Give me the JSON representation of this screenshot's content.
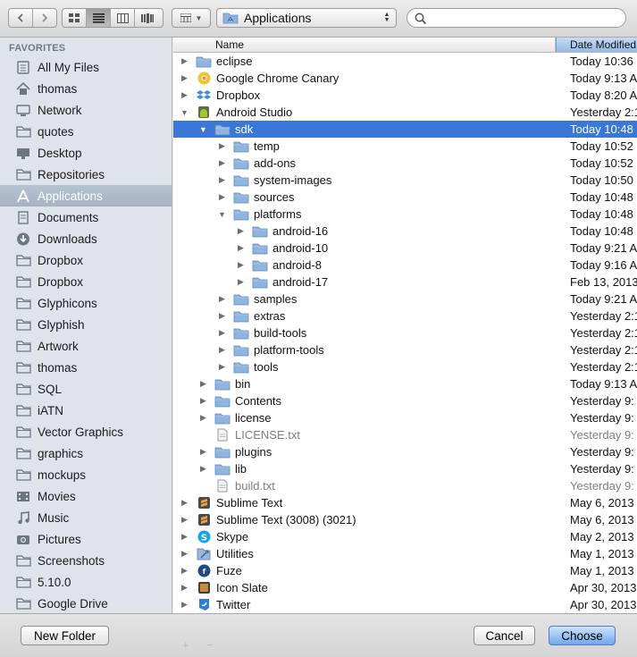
{
  "toolbar": {
    "back_icon": "chevron-left-icon",
    "forward_icon": "chevron-right-icon",
    "view_icons": [
      "icon-view-icon",
      "list-view-icon",
      "column-view-icon",
      "coverflow-view-icon"
    ],
    "path_label": "Applications",
    "search_placeholder": ""
  },
  "sidebar": {
    "heading": "FAVORITES",
    "items": [
      {
        "label": "All My Files",
        "icon": "all-files-icon"
      },
      {
        "label": "thomas",
        "icon": "home-icon"
      },
      {
        "label": "Network",
        "icon": "network-icon"
      },
      {
        "label": "quotes",
        "icon": "folder-icon"
      },
      {
        "label": "Desktop",
        "icon": "desktop-icon"
      },
      {
        "label": "Repositories",
        "icon": "folder-icon"
      },
      {
        "label": "Applications",
        "icon": "applications-icon",
        "selected": true
      },
      {
        "label": "Documents",
        "icon": "documents-icon"
      },
      {
        "label": "Downloads",
        "icon": "downloads-icon"
      },
      {
        "label": "Dropbox",
        "icon": "folder-icon"
      },
      {
        "label": "Dropbox",
        "icon": "folder-icon"
      },
      {
        "label": "Glyphicons",
        "icon": "folder-icon"
      },
      {
        "label": "Glyphish",
        "icon": "folder-icon"
      },
      {
        "label": "Artwork",
        "icon": "folder-icon"
      },
      {
        "label": "thomas",
        "icon": "folder-icon"
      },
      {
        "label": "SQL",
        "icon": "folder-icon"
      },
      {
        "label": "iATN",
        "icon": "folder-icon"
      },
      {
        "label": "Vector Graphics",
        "icon": "folder-icon"
      },
      {
        "label": "graphics",
        "icon": "folder-icon"
      },
      {
        "label": "mockups",
        "icon": "folder-icon"
      },
      {
        "label": "Movies",
        "icon": "movies-icon"
      },
      {
        "label": "Music",
        "icon": "music-icon"
      },
      {
        "label": "Pictures",
        "icon": "pictures-icon"
      },
      {
        "label": "Screenshots",
        "icon": "folder-icon"
      },
      {
        "label": "5.10.0",
        "icon": "folder-icon"
      },
      {
        "label": "Google Drive",
        "icon": "folder-icon"
      }
    ]
  },
  "list": {
    "col_name": "Name",
    "col_date": "Date Modified",
    "rows": [
      {
        "name": "eclipse",
        "date": "Today 10:36",
        "level": 0,
        "expand": "closed",
        "icon": "folder"
      },
      {
        "name": "Google Chrome Canary",
        "date": "Today 9:13 A",
        "level": 0,
        "expand": "closed",
        "icon": "chrome"
      },
      {
        "name": "Dropbox",
        "date": "Today 8:20 A",
        "level": 0,
        "expand": "closed",
        "icon": "dropbox"
      },
      {
        "name": "Android Studio",
        "date": "Yesterday 2:1",
        "level": 0,
        "expand": "open",
        "icon": "android"
      },
      {
        "name": "sdk",
        "date": "Today 10:48",
        "level": 1,
        "expand": "open",
        "icon": "folder",
        "selected": true
      },
      {
        "name": "temp",
        "date": "Today 10:52",
        "level": 2,
        "expand": "closed",
        "icon": "folder"
      },
      {
        "name": "add-ons",
        "date": "Today 10:52",
        "level": 2,
        "expand": "closed",
        "icon": "folder"
      },
      {
        "name": "system-images",
        "date": "Today 10:50",
        "level": 2,
        "expand": "closed",
        "icon": "folder"
      },
      {
        "name": "sources",
        "date": "Today 10:48",
        "level": 2,
        "expand": "closed",
        "icon": "folder"
      },
      {
        "name": "platforms",
        "date": "Today 10:48",
        "level": 2,
        "expand": "open",
        "icon": "folder"
      },
      {
        "name": "android-16",
        "date": "Today 10:48",
        "level": 3,
        "expand": "closed",
        "icon": "folder"
      },
      {
        "name": "android-10",
        "date": "Today 9:21 A",
        "level": 3,
        "expand": "closed",
        "icon": "folder"
      },
      {
        "name": "android-8",
        "date": "Today 9:16 A",
        "level": 3,
        "expand": "closed",
        "icon": "folder"
      },
      {
        "name": "android-17",
        "date": "Feb 13, 2013",
        "level": 3,
        "expand": "closed",
        "icon": "folder"
      },
      {
        "name": "samples",
        "date": "Today 9:21 A",
        "level": 2,
        "expand": "closed",
        "icon": "folder"
      },
      {
        "name": "extras",
        "date": "Yesterday 2:1",
        "level": 2,
        "expand": "closed",
        "icon": "folder"
      },
      {
        "name": "build-tools",
        "date": "Yesterday 2:1",
        "level": 2,
        "expand": "closed",
        "icon": "folder"
      },
      {
        "name": "platform-tools",
        "date": "Yesterday 2:1",
        "level": 2,
        "expand": "closed",
        "icon": "folder"
      },
      {
        "name": "tools",
        "date": "Yesterday 2:1",
        "level": 2,
        "expand": "closed",
        "icon": "folder"
      },
      {
        "name": "bin",
        "date": "Today 9:13 A",
        "level": 1,
        "expand": "closed",
        "icon": "folder"
      },
      {
        "name": "Contents",
        "date": "Yesterday 9:",
        "level": 1,
        "expand": "closed",
        "icon": "folder"
      },
      {
        "name": "license",
        "date": "Yesterday 9:",
        "level": 1,
        "expand": "closed",
        "icon": "folder"
      },
      {
        "name": "LICENSE.txt",
        "date": "Yesterday 9:",
        "level": 1,
        "expand": "none",
        "icon": "file",
        "dim": true
      },
      {
        "name": "plugins",
        "date": "Yesterday 9:",
        "level": 1,
        "expand": "closed",
        "icon": "folder"
      },
      {
        "name": "lib",
        "date": "Yesterday 9:",
        "level": 1,
        "expand": "closed",
        "icon": "folder"
      },
      {
        "name": "build.txt",
        "date": "Yesterday 9:",
        "level": 1,
        "expand": "none",
        "icon": "file",
        "dim": true
      },
      {
        "name": "Sublime Text",
        "date": "May 6, 2013",
        "level": 0,
        "expand": "closed",
        "icon": "sublime"
      },
      {
        "name": "Sublime Text (3008) (3021)",
        "date": "May 6, 2013",
        "level": 0,
        "expand": "closed",
        "icon": "sublime"
      },
      {
        "name": "Skype",
        "date": "May 2, 2013",
        "level": 0,
        "expand": "closed",
        "icon": "skype"
      },
      {
        "name": "Utilities",
        "date": "May 1, 2013",
        "level": 0,
        "expand": "closed",
        "icon": "utilities"
      },
      {
        "name": "Fuze",
        "date": "May 1, 2013",
        "level": 0,
        "expand": "closed",
        "icon": "fuze"
      },
      {
        "name": "Icon Slate",
        "date": "Apr 30, 2013",
        "level": 0,
        "expand": "closed",
        "icon": "iconslate"
      },
      {
        "name": "Twitter",
        "date": "Apr 30, 2013",
        "level": 0,
        "expand": "closed",
        "icon": "twitter"
      }
    ]
  },
  "footer": {
    "new_folder": "New Folder",
    "cancel": "Cancel",
    "choose": "Choose",
    "ghost_controls": "+ −"
  },
  "colors": {
    "selection": "#3b77d6",
    "sidebar_bg": "#dee4ea",
    "sidebar_selected": "#a9b6c6",
    "folder": "#7fa8d6"
  }
}
